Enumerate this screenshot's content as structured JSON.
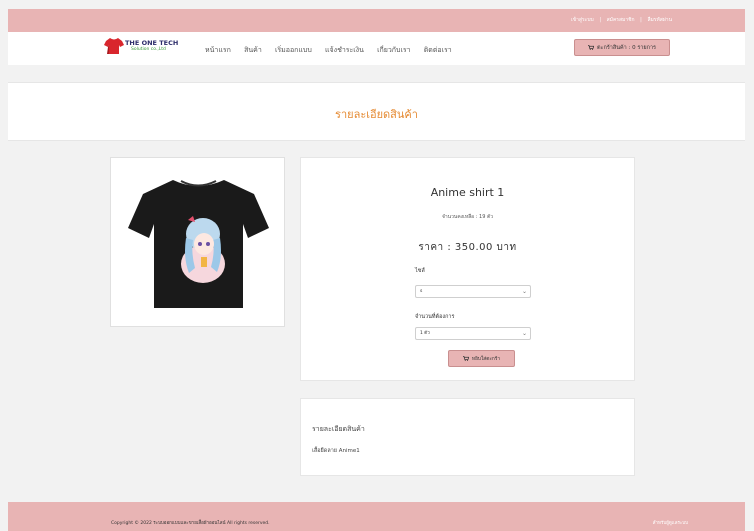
{
  "topbar": {
    "links": [
      "เข้าสู่ระบบ",
      "สมัครสมาชิก",
      "ลืมรหัสผ่าน"
    ],
    "separator": "|"
  },
  "nav": {
    "logo_title": "THE ONE TECH",
    "logo_subtitle": "Solution co.,Ltd",
    "menu": [
      "หน้าแรก",
      "สินค้า",
      "เริ่มออกแบบ",
      "แจ้งชำระเงิน",
      "เกี่ยวกับเรา",
      "ติดต่อเรา"
    ],
    "cart_label": "ตะกร้าสินค้า : 0 รายการ"
  },
  "banner": {
    "title": "รายละเอียดสินค้า"
  },
  "product": {
    "name": "Anime shirt 1",
    "stock": "จำนวนคงเหลือ : 19 ตัว",
    "price": "ราคา : 350.00 บาท",
    "size_label": "ไซส์",
    "size_value": "s",
    "qty_label": "จำนวนที่ต้องการ",
    "qty_value": "1 ตัว",
    "add_to_cart": "หยิบใส่ตะกร้า"
  },
  "description": {
    "title": "รายละเอียดสินค้า",
    "text": "เสื้อยืดลาย Anime1"
  },
  "footer": {
    "copyright_symbol": "©",
    "copyright": "Copyright © 2022 ระบบออกแบบและขายเสื้อผ้าออนไลน์ All rights reserved.",
    "member_link": "สำหรับผู้ดูแลระบบ"
  },
  "colors": {
    "accent_pink": "#e8b4b4",
    "title_orange": "#e58a32"
  },
  "icons": {
    "cart": "shopping-cart-icon",
    "chevron": "chevron-down-icon"
  }
}
